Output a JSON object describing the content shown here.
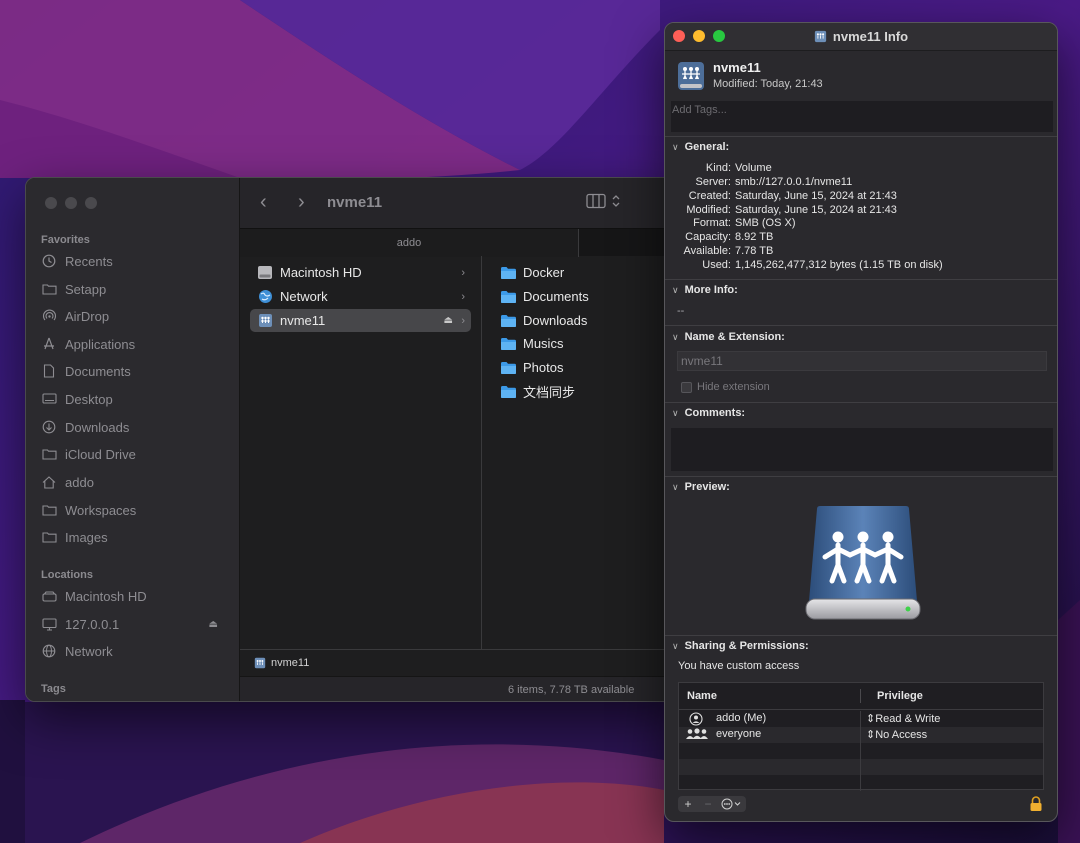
{
  "finder": {
    "window_title": "nvme11",
    "tab_label": "addo",
    "sidebar": {
      "favorites_heading": "Favorites",
      "favorites": [
        {
          "label": "Recents",
          "icon": "clock-icon"
        },
        {
          "label": "Setapp",
          "icon": "folder-icon"
        },
        {
          "label": "AirDrop",
          "icon": "airdrop-icon"
        },
        {
          "label": "Applications",
          "icon": "applications-icon"
        },
        {
          "label": "Documents",
          "icon": "document-icon"
        },
        {
          "label": "Desktop",
          "icon": "desktop-icon"
        },
        {
          "label": "Downloads",
          "icon": "download-icon"
        },
        {
          "label": "iCloud Drive",
          "icon": "folder-icon"
        },
        {
          "label": "addo",
          "icon": "home-icon"
        },
        {
          "label": "Workspaces",
          "icon": "folder-icon"
        },
        {
          "label": "Images",
          "icon": "folder-icon"
        }
      ],
      "locations_heading": "Locations",
      "locations": [
        {
          "label": "Macintosh HD",
          "icon": "disk-icon"
        },
        {
          "label": "127.0.0.1",
          "icon": "display-icon"
        },
        {
          "label": "Network",
          "icon": "globe-icon"
        }
      ],
      "tags_heading": "Tags"
    },
    "column1": [
      {
        "label": "Macintosh HD",
        "icon": "hard-drive-icon",
        "selected": false
      },
      {
        "label": "Network",
        "icon": "network-globe-icon",
        "selected": false
      },
      {
        "label": "nvme11",
        "icon": "server-volume-icon",
        "selected": true
      }
    ],
    "column2": [
      {
        "label": "Docker"
      },
      {
        "label": "Documents"
      },
      {
        "label": "Downloads"
      },
      {
        "label": "Musics"
      },
      {
        "label": "Photos"
      },
      {
        "label": "文档同步"
      }
    ],
    "path_label": "nvme11",
    "status": "6 items, 7.78 TB available"
  },
  "info": {
    "window_title": "nvme11 Info",
    "name": "nvme11",
    "modified_label": "Modified:",
    "modified_value": "Today, 21:43",
    "tags_placeholder": "Add Tags...",
    "general": {
      "heading": "General:",
      "rows": [
        {
          "key": "Kind:",
          "value": "Volume"
        },
        {
          "key": "Server:",
          "value": "smb://127.0.0.1/nvme11"
        },
        {
          "key": "Created:",
          "value": "Saturday, June 15, 2024 at 21:43"
        },
        {
          "key": "Modified:",
          "value": "Saturday, June 15, 2024 at 21:43"
        },
        {
          "key": "Format:",
          "value": "SMB (OS X)"
        },
        {
          "key": "Capacity:",
          "value": "8.92 TB"
        },
        {
          "key": "Available:",
          "value": "7.78 TB"
        },
        {
          "key": "Used:",
          "value": "1,145,262,477,312 bytes (1.15 TB on disk)"
        }
      ]
    },
    "more_info": {
      "heading": "More Info:",
      "value": "--"
    },
    "name_extension": {
      "heading": "Name & Extension:",
      "field_value": "nvme11",
      "hide_extension_label": "Hide extension"
    },
    "comments": {
      "heading": "Comments:"
    },
    "preview": {
      "heading": "Preview:"
    },
    "sharing": {
      "heading": "Sharing & Permissions:",
      "access_text": "You have custom access",
      "col_name": "Name",
      "col_privilege": "Privilege",
      "rows": [
        {
          "name": "addo (Me)",
          "privilege": "Read & Write",
          "icon": "user-icon"
        },
        {
          "name": "everyone",
          "privilege": "No Access",
          "icon": "group-icon"
        }
      ]
    }
  }
}
